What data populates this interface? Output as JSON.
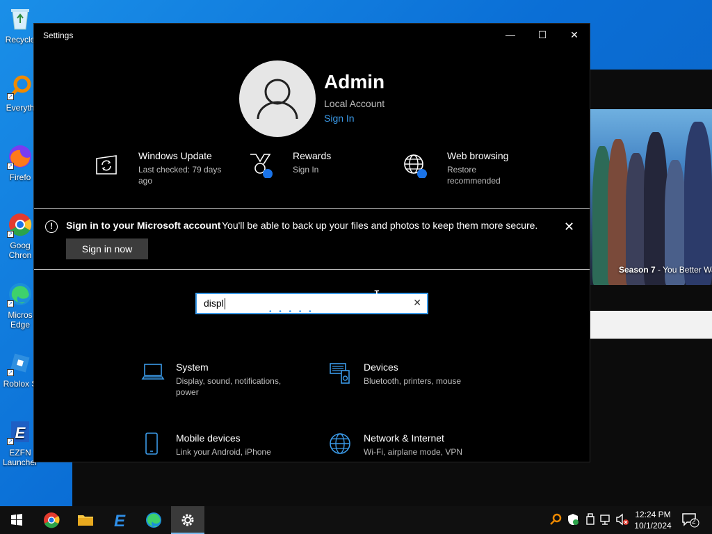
{
  "desktop": {
    "icons": [
      {
        "label": "Recycle",
        "name": "recycle-bin"
      },
      {
        "label": "Everyth",
        "name": "everything"
      },
      {
        "label": "Firefo",
        "name": "firefox"
      },
      {
        "label": "Goog Chron",
        "name": "google-chrome"
      },
      {
        "label": "Micros Edge",
        "name": "microsoft-edge"
      },
      {
        "label": "Roblox S",
        "name": "roblox-studio"
      },
      {
        "label": "EZFN Launcher",
        "name": "ezfn-launcher"
      }
    ]
  },
  "bg_window": {
    "caption_bold": "Season 7",
    "caption_rest": " - You Better Wa"
  },
  "settings": {
    "title": "Settings",
    "controls": {
      "minimize": "—",
      "maximize": "☐",
      "close": "✕"
    },
    "user": {
      "name": "Admin",
      "account_type": "Local Account",
      "sign_in_link": "Sign In"
    },
    "quick": [
      {
        "title": "Windows Update",
        "subtitle": "Last checked: 79 days ago"
      },
      {
        "title": "Rewards",
        "subtitle": "Sign In"
      },
      {
        "title": "Web browsing",
        "subtitle": "Restore recommended"
      }
    ],
    "banner": {
      "title": "Sign in to your Microsoft account",
      "text": "You'll be able to back up your files and photos to keep them more secure.",
      "button": "Sign in now",
      "close": "✕"
    },
    "search": {
      "value": "displ",
      "clear": "✕",
      "loading": "• • • • •"
    },
    "categories": [
      {
        "title": "System",
        "subtitle": "Display, sound, notifications,",
        "subtitle2": "power"
      },
      {
        "title": "Devices",
        "subtitle": "Bluetooth, printers, mouse",
        "subtitle2": ""
      },
      {
        "title": "Mobile devices",
        "subtitle": "Link your Android, iPhone",
        "subtitle2": ""
      },
      {
        "title": "Network & Internet",
        "subtitle": "Wi-Fi, airplane mode, VPN",
        "subtitle2": ""
      }
    ]
  },
  "taskbar": {
    "time": "12:24 PM",
    "date": "10/1/2024",
    "notification_count": "2"
  },
  "colors": {
    "accent": "#3b9ae8",
    "window_bg": "#000000",
    "taskbar_bg": "#101010"
  }
}
